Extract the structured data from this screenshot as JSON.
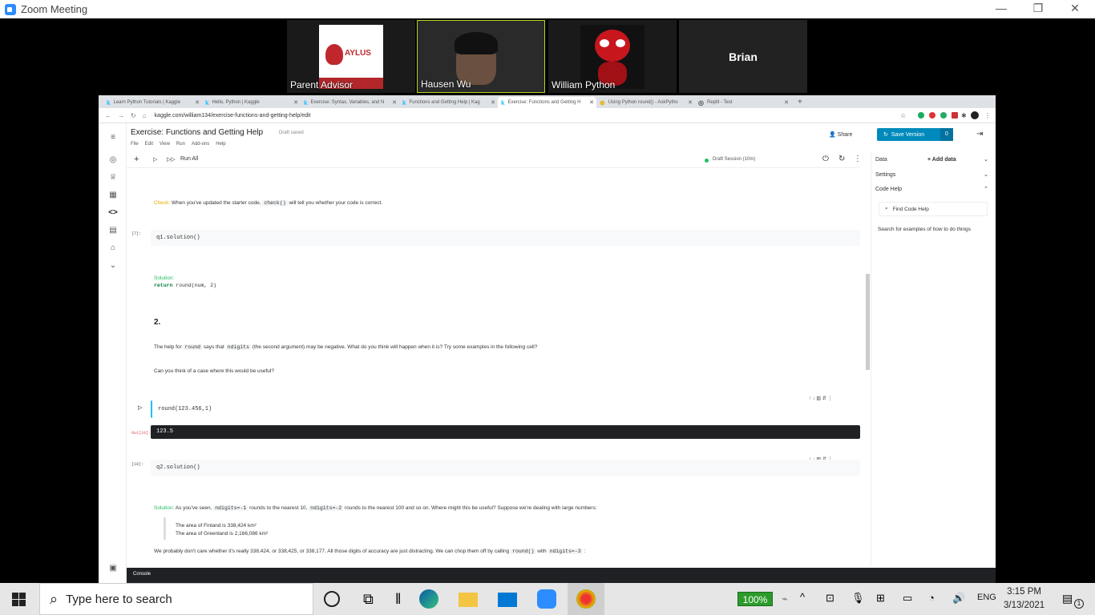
{
  "zoom": {
    "title": "Zoom Meeting",
    "participants": [
      "Parent Advisor",
      "Hausen Wu",
      "William Python",
      "Brian"
    ],
    "advisor_logo": "AYLUS"
  },
  "browser": {
    "tabs": [
      "Learn Python Tutorials | Kaggle",
      "Hello, Python | Kaggle",
      "Exercise: Syntax, Variables, and N",
      "Functions and Getting Help | Kag",
      "Exercise: Functions and Getting H",
      "Using Python round() - AskPytho",
      "Replit - Test"
    ],
    "url": "kaggle.com/william134/exercise-functions-and-getting-help/edit"
  },
  "notebook": {
    "title": "Exercise: Functions and Getting Help",
    "status": "Draft saved",
    "menu": [
      "File",
      "Edit",
      "View",
      "Run",
      "Add-ons",
      "Help"
    ],
    "share": "Share",
    "save_version": "Save Version",
    "save_count": "0",
    "run_all": "Run All",
    "session": "Draft Session (10m)",
    "check_label": "Check:",
    "check_text_1": "When you've updated the starter code,",
    "check_code": "check()",
    "check_text_2": "will tell you whether your code is correct.",
    "prompt_q1": "[7]:",
    "cell_q1": "q1.solution()",
    "solution_label": "Solution:",
    "solution_code_kw": "return",
    "solution_code": " round(num, 2)",
    "heading_2": "2.",
    "q2_text_1": "The help for",
    "q2_code_round": "round",
    "q2_text_2": "says that",
    "q2_code_nd": "ndigits",
    "q2_text_3": "(the second argument) may be negative. What do you think will happen when it is? Try some examples",
    "q2_text_4": "in the following cell?",
    "q2_text_5": "Can you think of a case where this would be useful?",
    "cell_round": "round(123.456,1)",
    "out_prompt": "Out[10]:",
    "out_value": "123.5",
    "prompt_q2": "[10]:",
    "cell_q2": "q2.solution()",
    "sol2_text_1": "As you've seen,",
    "sol2_code_1": "ndigits=-1",
    "sol2_text_2": "rounds to the nearest 10,",
    "sol2_code_2": "ndigits=-2",
    "sol2_text_3": "rounds to the nearest 100 and so on. Where might this be useful? Suppose we're dealing with large numbers:",
    "quote_1": "The area of Finland is 338,424 km²",
    "quote_2": "The area of Greenland is 2,166,086 km²",
    "sol2_text_4": "We probably don't care whether it's really 338,424, or 338,425, or 338,177. All those digits of accuracy are just distracting. We can chop them off by calling",
    "sol2_code_3": "round()",
    "sol2_text_5": "with",
    "sol2_code_4": "ndigits=-3",
    "sol2_text_6": ":",
    "console": "Console"
  },
  "right_panel": {
    "data": "Data",
    "add_data": "Add data",
    "settings": "Settings",
    "code_help": "Code Help",
    "find_code_help": "Find Code Help",
    "search_hint": "Search for examples of how to do things"
  },
  "taskbar": {
    "search_placeholder": "Type here to search",
    "battery": "100%",
    "lang": "ENG",
    "time": "3:15 PM",
    "date": "3/13/2021",
    "notif_count": "1"
  }
}
